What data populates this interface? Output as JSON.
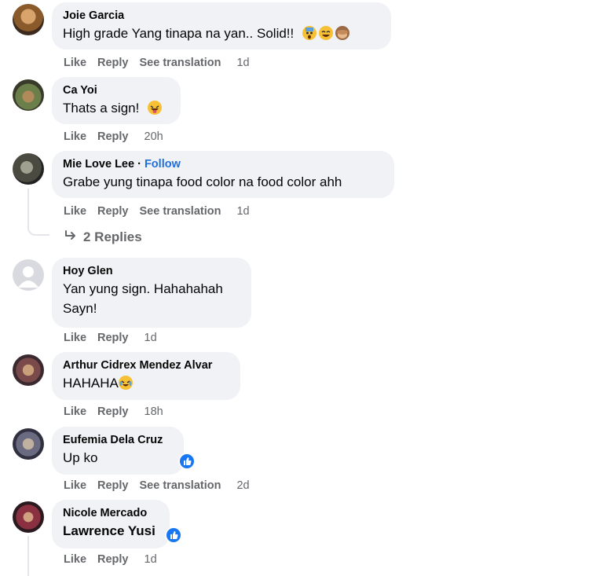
{
  "comments": [
    {
      "author": "Joie Garcia",
      "text": "High grade Yang tinapa na yan.. Solid!!",
      "actions": {
        "like": "Like",
        "reply": "Reply",
        "translate": "See translation",
        "time": "1d"
      }
    },
    {
      "author": "Ca Yoi",
      "text": "Thats a sign!",
      "actions": {
        "like": "Like",
        "reply": "Reply",
        "time": "20h"
      }
    },
    {
      "author": "Mie Love Lee",
      "follow_sep": " · ",
      "follow": "Follow",
      "text": "Grabe yung tinapa food color na food color ahh",
      "actions": {
        "like": "Like",
        "reply": "Reply",
        "translate": "See translation",
        "time": "1d"
      },
      "replies_label": "2 Replies"
    },
    {
      "author": "Hoy Glen",
      "text_line1": "Yan yung sign. Hahahahah",
      "text_line2": "Sayn!",
      "actions": {
        "like": "Like",
        "reply": "Reply",
        "time": "1d"
      }
    },
    {
      "author": "Arthur Cidrex Mendez Alvar",
      "text": "HAHAHA",
      "actions": {
        "like": "Like",
        "reply": "Reply",
        "time": "18h"
      }
    },
    {
      "author": "Eufemia Dela Cruz",
      "text": "Up ko",
      "actions": {
        "like": "Like",
        "reply": "Reply",
        "translate": "See translation",
        "time": "2d"
      }
    },
    {
      "author": "Nicole Mercado",
      "mention": "Lawrence Yusi",
      "actions": {
        "like": "Like",
        "reply": "Reply",
        "time": "1d"
      }
    }
  ],
  "icons": {
    "reply_arrow": "reply-arrow-icon",
    "like_reaction": "like-reaction-icon",
    "default_avatar": "default-avatar-icon"
  },
  "colors": {
    "bubble": "#f0f2f5",
    "secondary_text": "#65676b",
    "link": "#216fdb",
    "like_blue": "#1877f2"
  }
}
